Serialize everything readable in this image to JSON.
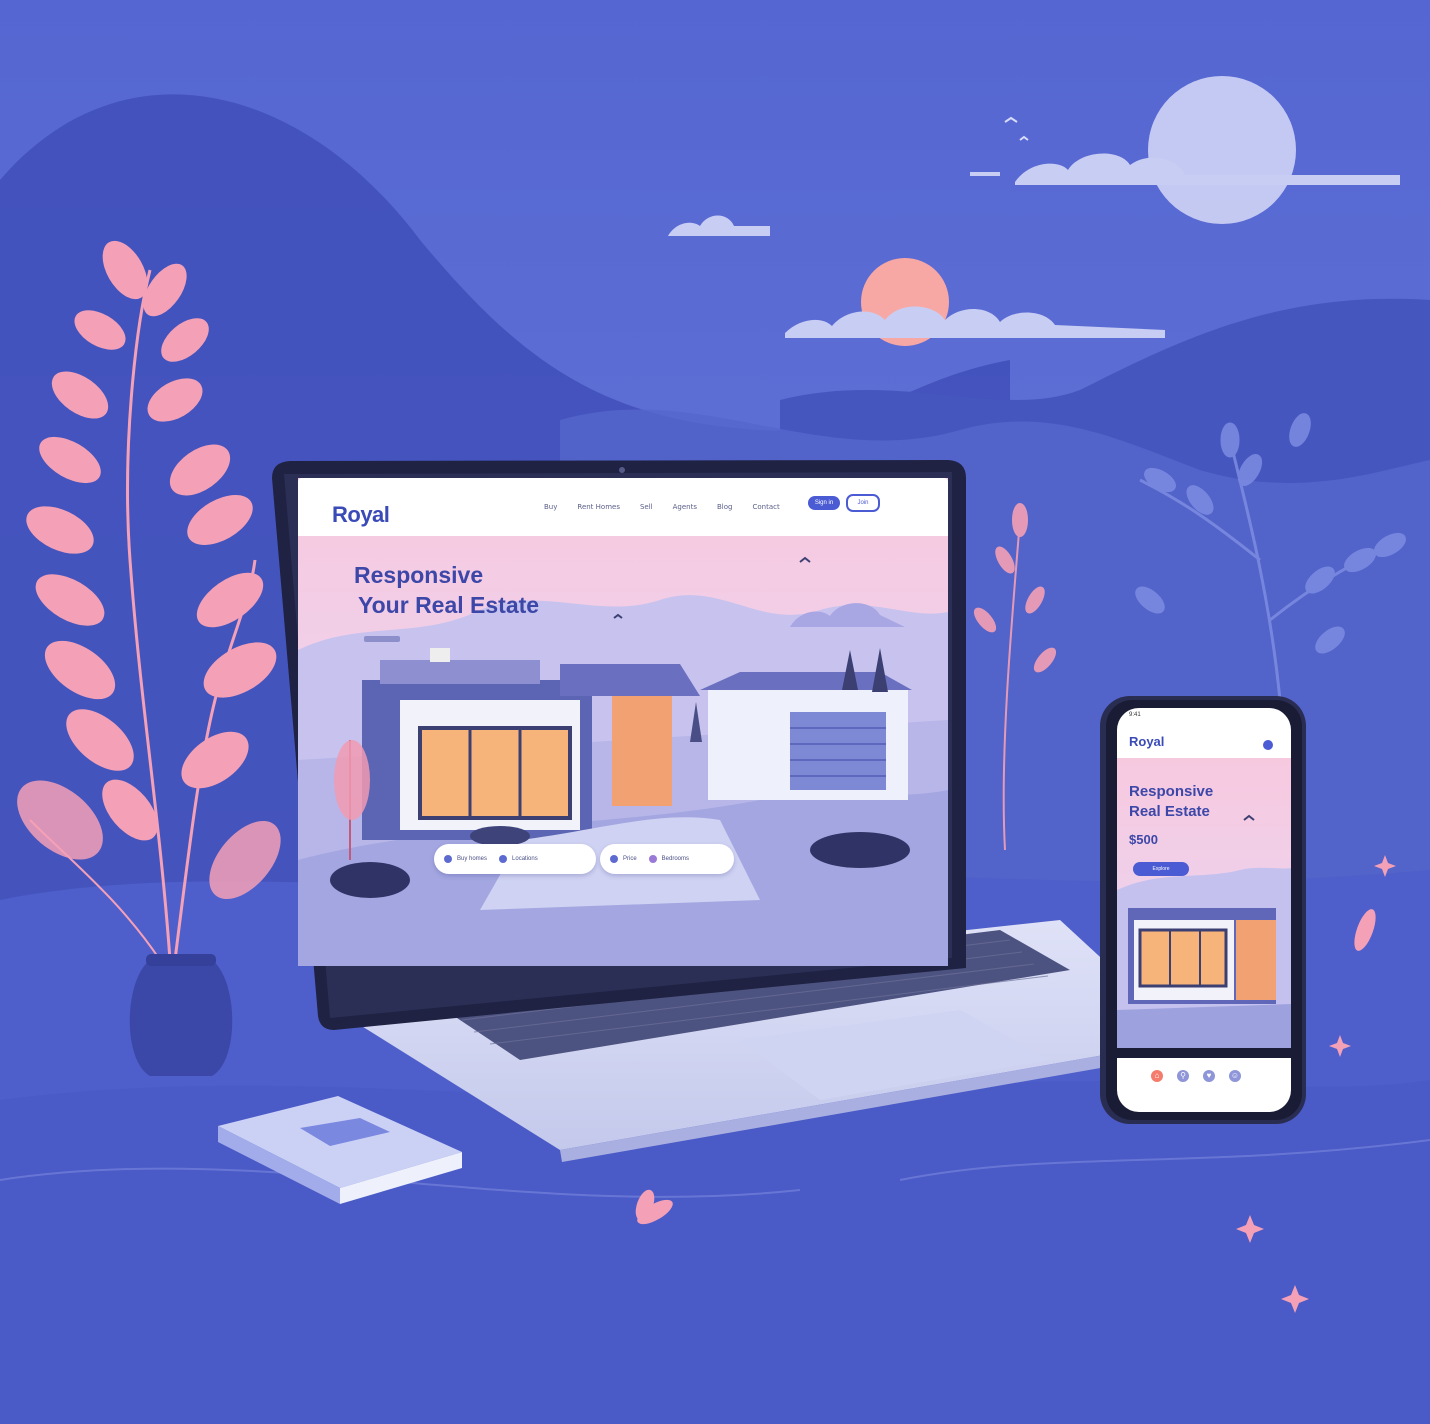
{
  "laptop_site": {
    "logo": "Royal",
    "nav_links": [
      "Buy",
      "Rent Homes",
      "Sell",
      "Agents",
      "Blog",
      "Contact"
    ],
    "nav_button_primary": "Sign in",
    "nav_button_outline": "Join",
    "hero_title_line1": "Responsive",
    "hero_title_line2": "Your Real Estate",
    "search_options": [
      "Buy homes",
      "Locations",
      "Price",
      "Bedrooms"
    ]
  },
  "phone_site": {
    "status_time": "9:41",
    "logo": "Royal",
    "hero_title_line1": "Responsive",
    "hero_title_line2": "Real Estate",
    "price": "$500",
    "cta": "Explore"
  },
  "colors": {
    "background": "#5d6fd4",
    "accent": "#4b5bd3",
    "pink": "#f4a0b6",
    "moon": "#cfd4f5",
    "sun": "#f8a8a4"
  }
}
